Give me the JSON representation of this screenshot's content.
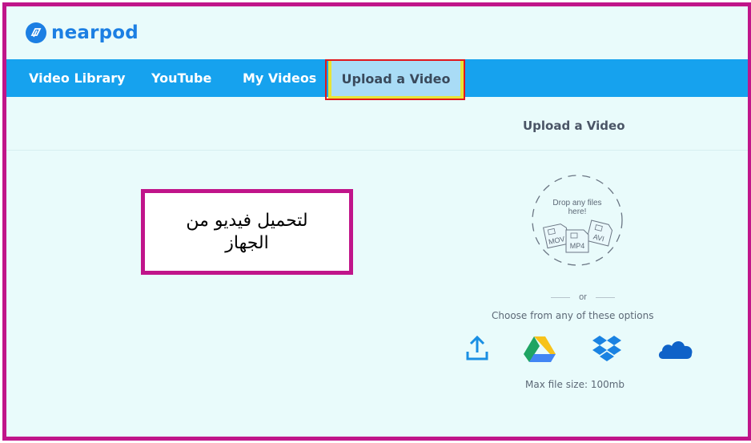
{
  "app": {
    "logo_text": "nearpod"
  },
  "nav": {
    "tabs": [
      {
        "label": "Video Library"
      },
      {
        "label": "YouTube"
      },
      {
        "label": "My Videos"
      },
      {
        "label": "Upload a Video"
      }
    ]
  },
  "subheader": {
    "title": "Upload a Video"
  },
  "callout": {
    "text": "لتحميل فيديو من الجهاز"
  },
  "dropzone": {
    "line1": "Drop any files",
    "line2": "here!",
    "formats": [
      "MOV",
      "MP4",
      "AVI"
    ]
  },
  "divider": {
    "text": "or"
  },
  "options": {
    "prompt": "Choose from any of these options",
    "icons": [
      "upload-from-device-icon",
      "google-drive-icon",
      "dropbox-icon",
      "onedrive-icon"
    ]
  },
  "limits": {
    "max_file_size": "Max file size: 100mb"
  },
  "colors": {
    "brand_blue": "#1c7fe3",
    "nav_blue": "#16a2ee",
    "highlight_magenta": "#c0158a",
    "selection_red": "#e0161c",
    "selection_yellow": "#e9e436"
  }
}
